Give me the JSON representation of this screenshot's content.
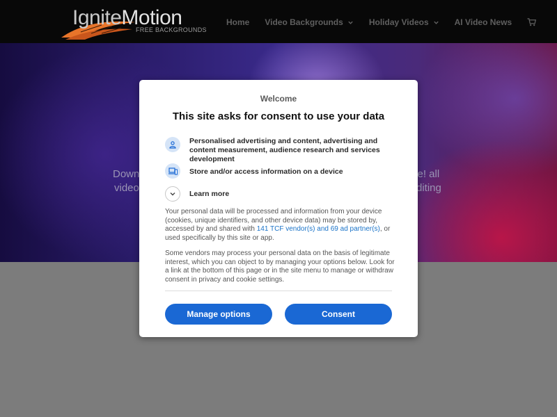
{
  "header": {
    "logo": {
      "name_part1": "Ignite",
      "name_part2": "Motion",
      "tagline": "FREE BACKGROUNDS"
    },
    "nav": [
      {
        "label": "Home",
        "has_dropdown": false
      },
      {
        "label": "Video Backgrounds",
        "has_dropdown": true
      },
      {
        "label": "Holiday Videos",
        "has_dropdown": true
      },
      {
        "label": "AI Video News",
        "has_dropdown": false
      }
    ],
    "cart_icon": "shopping-cart-icon"
  },
  "hero": {
    "text_left_1": "Downl",
    "text_left_2": "video",
    "text_right_1": "se! all",
    "text_right_2": "diting"
  },
  "consent": {
    "welcome": "Welcome",
    "title": "This site asks for consent to use your data",
    "purposes": [
      {
        "icon": "person-icon",
        "text": "Personalised advertising and content, advertising and content measurement, audience research and services development"
      },
      {
        "icon": "devices-icon",
        "text": "Store and/or access information on a device"
      }
    ],
    "learn_more": "Learn more",
    "para1_before": "Your personal data will be processed and information from your device (cookies, unique identifiers, and other device data) may be stored by, accessed by and shared with ",
    "para1_link": "141 TCF vendor(s) and 69 ad partner(s)",
    "para1_after": ", or used specifically by this site or app.",
    "para2": "Some vendors may process your personal data on the basis of legitimate interest, which you can object to by managing your options below. Look for a link at the bottom of this page or in the site menu to manage or withdraw consent in privacy and cookie settings.",
    "manage_button": "Manage options",
    "consent_button": "Consent"
  },
  "colors": {
    "header_bg": "#080808",
    "button_blue": "#1a68d4",
    "link_blue": "#1a73c8",
    "page_bg": "#7c7c7c"
  }
}
